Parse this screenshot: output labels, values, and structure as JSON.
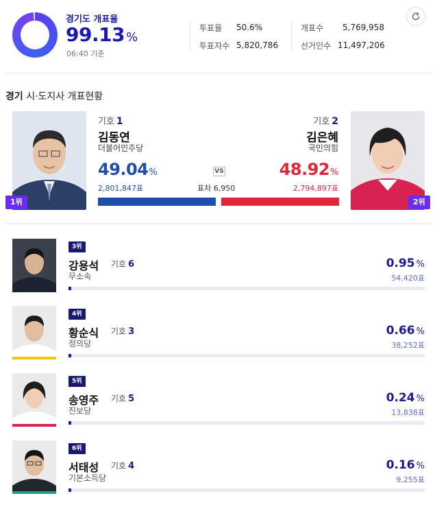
{
  "summary": {
    "title": "경기도 개표율",
    "rate": "99.13",
    "rate_unit": "%",
    "time": "06:40 기준",
    "turnout_label": "투표율",
    "turnout_value": "50.6%",
    "voters_label": "투표자수",
    "voters_value": "5,820,786",
    "counted_label": "개표수",
    "counted_value": "5,769,958",
    "electorate_label": "선거인수",
    "electorate_value": "11,497,206",
    "refresh_icon": "refresh-icon"
  },
  "section": {
    "region": "경기",
    "title": "시·도지사 개표현황"
  },
  "colors": {
    "accent": "#1a1ab0",
    "party_blue": "#1f4fa8",
    "party_red": "#e1253a",
    "rank_badge": "#6a2cf0"
  },
  "top": {
    "vs_label": "VS",
    "gap_label": "표차",
    "gap_value": "6,950",
    "ballot_label": "기호",
    "candidates": [
      {
        "rank": "1위",
        "number": "1",
        "name": "김동연",
        "party": "더불어민주당",
        "pct": "49.04",
        "unit": "%",
        "votes": "2,801,847표",
        "share": 49.04
      },
      {
        "rank": "2위",
        "number": "2",
        "name": "김은혜",
        "party": "국민의힘",
        "pct": "48.92",
        "unit": "%",
        "votes": "2,794,897표",
        "share": 48.92
      }
    ]
  },
  "others": [
    {
      "rank": "3위",
      "name": "강용석",
      "ballot_label": "기호",
      "number": "6",
      "party": "무소속",
      "pct": "0.95",
      "unit": "%",
      "votes": "54,420표",
      "share": 0.95
    },
    {
      "rank": "4위",
      "name": "황순식",
      "ballot_label": "기호",
      "number": "3",
      "party": "정의당",
      "pct": "0.66",
      "unit": "%",
      "votes": "38,252표",
      "share": 0.66
    },
    {
      "rank": "5위",
      "name": "송영주",
      "ballot_label": "기호",
      "number": "5",
      "party": "진보당",
      "pct": "0.24",
      "unit": "%",
      "votes": "13,838표",
      "share": 0.24
    },
    {
      "rank": "6위",
      "name": "서태성",
      "ballot_label": "기호",
      "number": "4",
      "party": "기본소득당",
      "pct": "0.16",
      "unit": "%",
      "votes": "9,255표",
      "share": 0.16
    }
  ]
}
